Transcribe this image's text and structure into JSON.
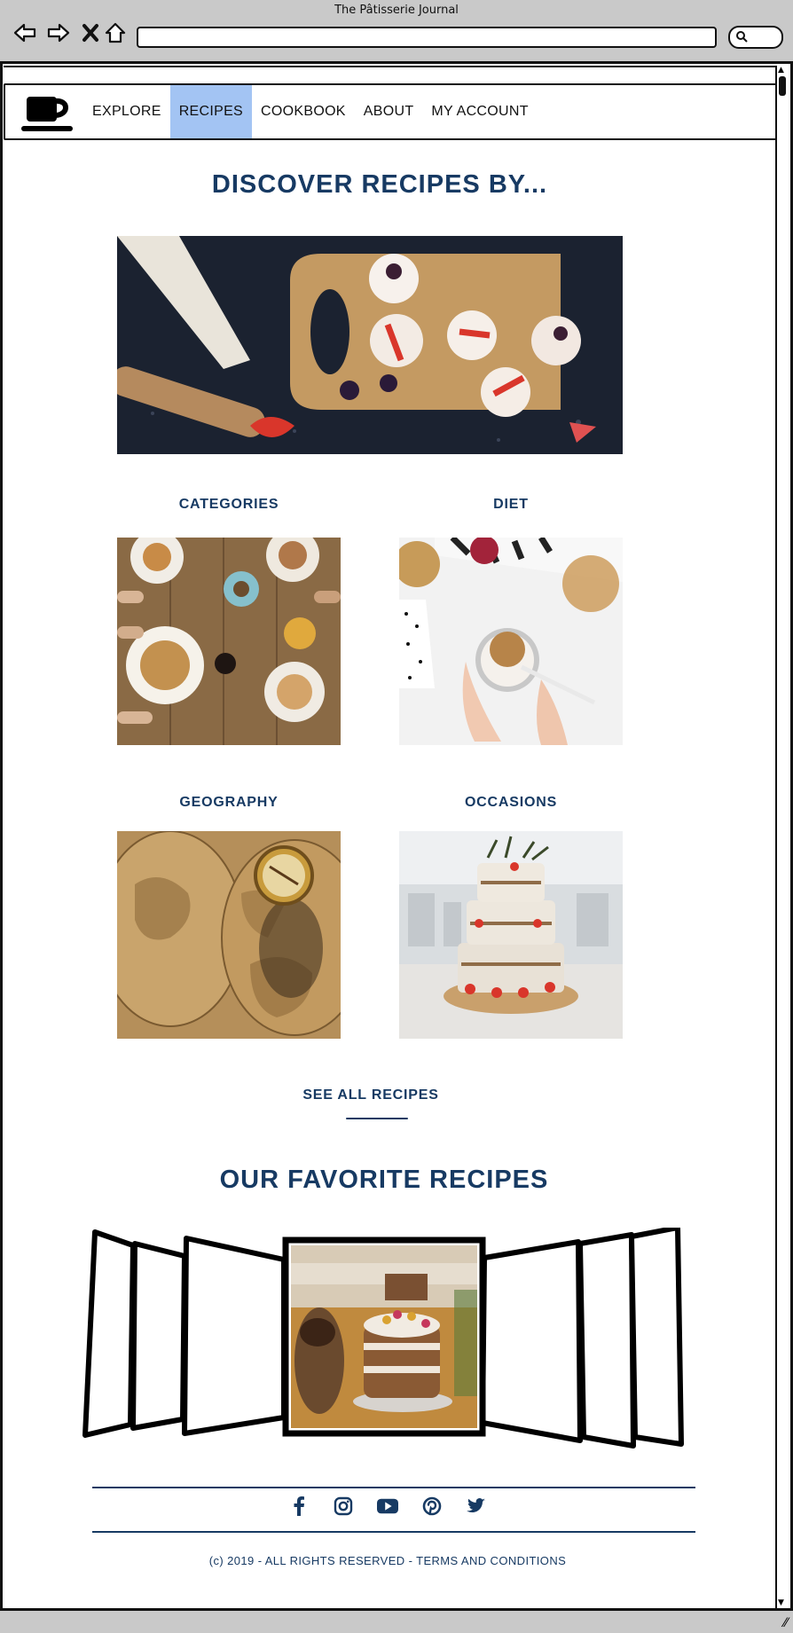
{
  "window": {
    "title": "The Pâtisserie Journal"
  },
  "browser": {
    "back_icon": "arrow-left-icon",
    "forward_icon": "arrow-right-icon",
    "stop_icon": "close-icon",
    "home_icon": "home-icon",
    "url_value": "",
    "search_icon": "search-icon"
  },
  "header": {
    "logo_icon": "coffee-cup-icon",
    "nav": [
      {
        "label": "EXPLORE",
        "active": false
      },
      {
        "label": "RECIPES",
        "active": true
      },
      {
        "label": "COOKBOOK",
        "active": false
      },
      {
        "label": "ABOUT",
        "active": false
      },
      {
        "label": "MY ACCOUNT",
        "active": false
      }
    ],
    "active_color": "#a3c4f3"
  },
  "main": {
    "heading": "DISCOVER RECIPES BY...",
    "hero_image": "cupcakes-on-cutting-board",
    "categories": [
      {
        "label": "CATEGORIES",
        "image": "brunch-table"
      },
      {
        "label": "DIET",
        "image": "granola-yogurt-bowl"
      },
      {
        "label": "GEOGRAPHY",
        "image": "antique-map-with-compass"
      },
      {
        "label": "OCCASIONS",
        "image": "wedding-cake"
      }
    ],
    "see_all": "SEE ALL RECIPES",
    "favorites_heading": "OUR FAVORITE RECIPES",
    "carousel_image": "layered-cake-display"
  },
  "footer": {
    "social": [
      "facebook-icon",
      "instagram-icon",
      "youtube-icon",
      "pinterest-icon",
      "twitter-icon"
    ],
    "text": "(c) 2019 - ALL RIGHTS RESERVED - TERMS AND CONDITIONS"
  },
  "colors": {
    "primary": "#173a63",
    "chrome": "#c9c9c9"
  }
}
